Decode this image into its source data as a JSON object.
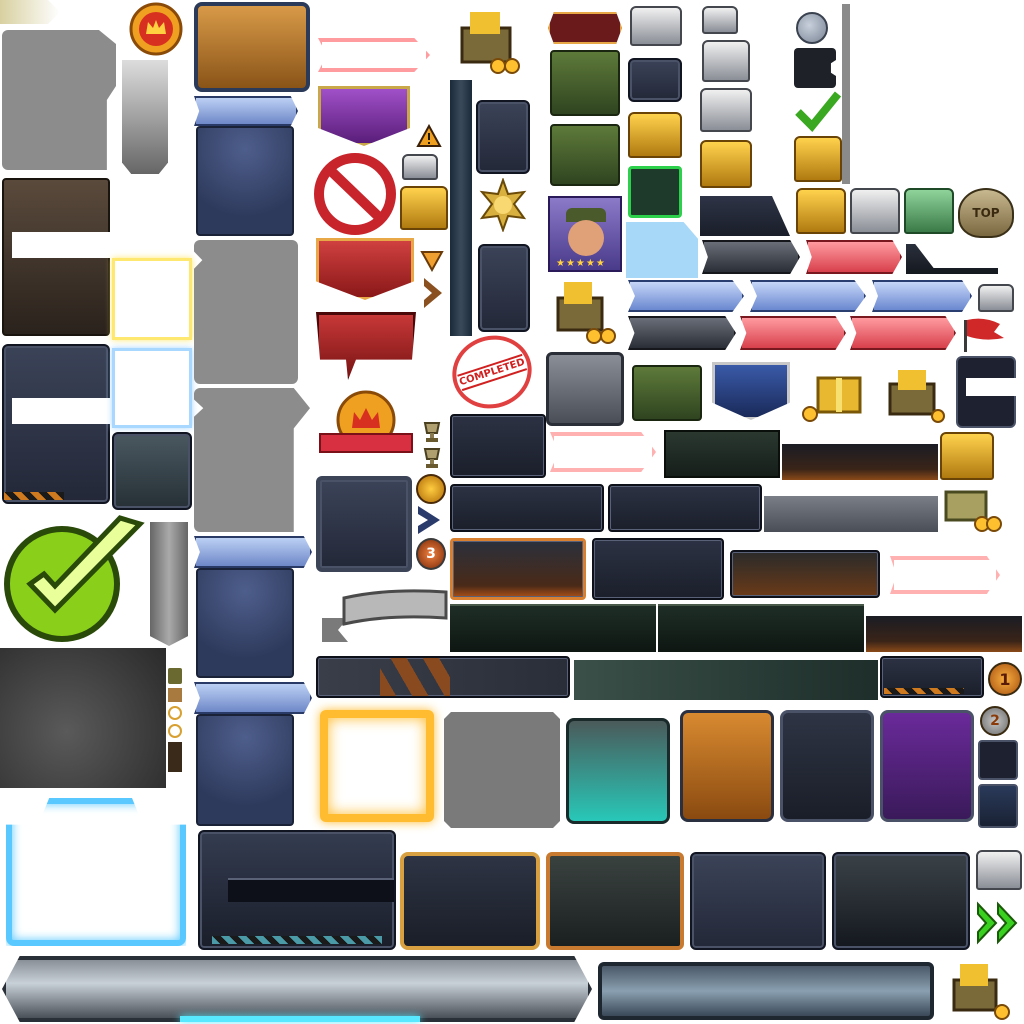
{
  "sprite_sheet": {
    "stamp_text": "COMPLETED",
    "trophy_text": "TOP",
    "rank_badges": [
      "1",
      "2",
      "3"
    ]
  }
}
